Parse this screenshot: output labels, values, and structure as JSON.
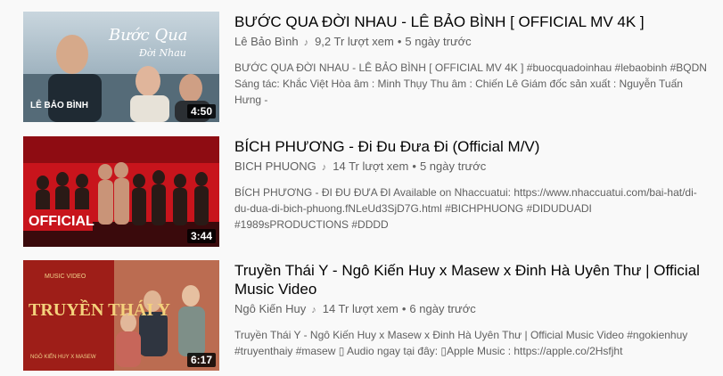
{
  "results": [
    {
      "title": "BƯỚC QUA ĐỜI NHAU - LÊ BẢO BÌNH [ OFFICIAL MV 4K ]",
      "channel": "Lê Bảo Bình",
      "channel_icon": "music-note-icon",
      "views": "9,2 Tr lượt xem",
      "age": "5 ngày trước",
      "separator": "•",
      "description": "BƯỚC QUA ĐỜI NHAU - LÊ BẢO BÌNH [ OFFICIAL MV 4K ] #buocquadoinhau #lebaobinh #BQDN Sáng tác: Khắc Việt Hòa âm : Minh Thụy Thu âm : Chiến Lê Giám đốc sản xuất : Nguyễn Tuấn Hưng -",
      "duration": "4:50",
      "thumbnail_text": "Bước Qua",
      "thumbnail_subtext": "Đời Nhau",
      "thumbnail_badge": "LÊ BẢO BÌNH"
    },
    {
      "title": "BÍCH PHƯƠNG - Đi Đu Đưa Đi (Official M/V)",
      "channel": "BICH PHUONG",
      "channel_icon": "music-note-icon",
      "views": "14 Tr lượt xem",
      "age": "5 ngày trước",
      "separator": "•",
      "description": "BÍCH PHƯƠNG - ĐI ĐU ĐƯA ĐI Available on Nhaccuatui: https://www.nhaccuatui.com/bai-hat/di-du-dua-di-bich-phuong.fNLeUd3SjD7G.html #BICHPHUONG #DIDUDUADI #1989sPRODUCTIONS #DDDD",
      "duration": "3:44",
      "thumbnail_badge": "OFFICIAL"
    },
    {
      "title": "Truyền Thái Y - Ngô Kiến Huy x Masew x Đinh Hà Uyên Thư | Official Music Video",
      "channel": "Ngô Kiến Huy",
      "channel_icon": "music-note-icon",
      "views": "14 Tr lượt xem",
      "age": "6 ngày trước",
      "separator": "•",
      "description": "Truyền Thái Y - Ngô Kiến Huy x Masew x Đinh Hà Uyên Thư | Official Music Video #ngokienhuy #truyenthaiy #masew ▯ Audio ngay tại đây: ▯Apple Music : https://apple.co/2Hsfjht",
      "duration": "6:17",
      "thumbnail_text": "TRUYỀN THÁI Y",
      "thumbnail_toptext": "MUSIC VIDEO",
      "thumbnail_subtext": "NGÔ KIẾN HUY X MASEW"
    }
  ],
  "colors": {
    "background": "#f9f9f9",
    "title": "#030303",
    "meta": "#606060",
    "thumb1_sky": "#9fb7c8",
    "thumb2_red": "#c8141c",
    "thumb3_red": "#b5231c"
  }
}
